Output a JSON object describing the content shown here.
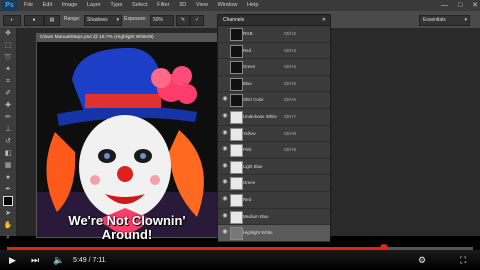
{
  "app": {
    "logo": "Ps",
    "menu": [
      "File",
      "Edit",
      "Image",
      "Layer",
      "Type",
      "Select",
      "Filter",
      "3D",
      "View",
      "Window",
      "Help"
    ],
    "window_controls": [
      "—",
      "□",
      "✕"
    ]
  },
  "options_bar": {
    "mode_label": "Range:",
    "mode_value": "Shadows",
    "exposure_label": "Exposure:",
    "exposure_value": "50%",
    "workspace": "Essentials"
  },
  "document": {
    "tab_title": "Clown ManualSteps.psd @ 16.7% (Highlight White/8)"
  },
  "channels_panel": {
    "title": "Channels",
    "close": "✕",
    "channels": [
      {
        "name": "RGB",
        "key": "Ctrl+2",
        "visible": false,
        "thumb": "dark",
        "selected": false
      },
      {
        "name": "Red",
        "key": "Ctrl+3",
        "visible": false,
        "thumb": "dark",
        "selected": false
      },
      {
        "name": "Green",
        "key": "Ctrl+4",
        "visible": false,
        "thumb": "dark",
        "selected": false
      },
      {
        "name": "Blue",
        "key": "Ctrl+5",
        "visible": false,
        "thumb": "dark",
        "selected": false
      },
      {
        "name": "Shirt Color",
        "key": "Ctrl+6",
        "visible": true,
        "thumb": "dark",
        "selected": false
      },
      {
        "name": "Underbase White",
        "key": "Ctrl+7",
        "visible": true,
        "thumb": "white",
        "selected": false
      },
      {
        "name": "Yellow",
        "key": "Ctrl+8",
        "visible": true,
        "thumb": "white",
        "selected": false
      },
      {
        "name": "Pink",
        "key": "Ctrl+9",
        "visible": true,
        "thumb": "white",
        "selected": false
      },
      {
        "name": "Light Blue",
        "key": "",
        "visible": true,
        "thumb": "white",
        "selected": false
      },
      {
        "name": "Green",
        "key": "",
        "visible": true,
        "thumb": "white",
        "selected": false
      },
      {
        "name": "Red",
        "key": "",
        "visible": true,
        "thumb": "white",
        "selected": false
      },
      {
        "name": "Medium Blue",
        "key": "",
        "visible": true,
        "thumb": "white",
        "selected": false
      },
      {
        "name": "Highlight White",
        "key": "",
        "visible": true,
        "thumb": "mid",
        "selected": true
      }
    ]
  },
  "caption": {
    "line1": "We're Not Clownin'",
    "line2": "Around!"
  },
  "player": {
    "time_current": "5:49",
    "time_total": "7:11",
    "time_separator": " / ",
    "played_fraction": 0.81,
    "progress_color": "#e62117",
    "icons": [
      "play-icon",
      "next-icon",
      "volume-icon",
      "settings-icon",
      "fullscreen-icon"
    ]
  }
}
